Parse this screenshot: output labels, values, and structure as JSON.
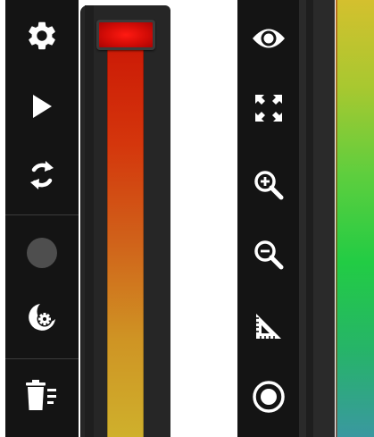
{
  "left_toolbar": {
    "tools": [
      {
        "name": "settings",
        "icon": "gear-icon"
      },
      {
        "name": "play",
        "icon": "play-icon"
      },
      {
        "name": "refresh",
        "icon": "refresh-icon"
      },
      {
        "name": "record",
        "icon": "record-dot-icon"
      },
      {
        "name": "theme-settings",
        "icon": "moon-gear-icon"
      },
      {
        "name": "delete",
        "icon": "trash-list-icon"
      }
    ]
  },
  "left_color_scale": {
    "gradient_colors": [
      "#cc1a06",
      "#d4360c",
      "#d0621a",
      "#cf9424",
      "#cfb02c"
    ],
    "handle_color": "#d40c06"
  },
  "right_toolbar": {
    "tools": [
      {
        "name": "visibility",
        "icon": "eye-icon"
      },
      {
        "name": "fit-to-screen",
        "icon": "expand-arrows-icon"
      },
      {
        "name": "zoom-in",
        "icon": "zoom-in-icon"
      },
      {
        "name": "zoom-out",
        "icon": "zoom-out-icon"
      },
      {
        "name": "measure",
        "icon": "set-square-icon"
      },
      {
        "name": "target",
        "icon": "target-circle-icon"
      }
    ]
  },
  "right_color_scale": {
    "gradient_colors": [
      "#d4c02e",
      "#a8c830",
      "#5ece3e",
      "#22cc44",
      "#26b468",
      "#3a98a0"
    ]
  }
}
